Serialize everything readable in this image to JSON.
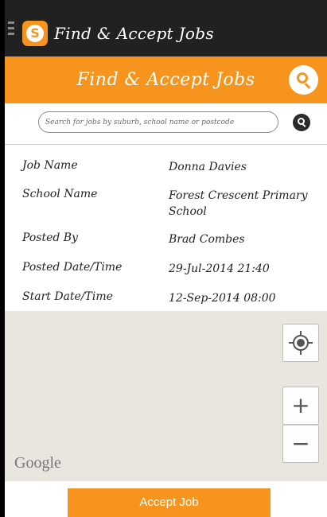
{
  "app": {
    "title": "Find & Accept Jobs",
    "logo_letter": "S"
  },
  "header": {
    "title": "Find & Accept Jobs"
  },
  "search": {
    "placeholder": "Search for jobs by suburb, school name or postcode"
  },
  "details": [
    {
      "label": "Job Name",
      "value": "Donna Davies"
    },
    {
      "label": "School Name",
      "value": "Forest Crescent Primary School"
    },
    {
      "label": "Posted By",
      "value": "Brad Combes"
    },
    {
      "label": "Posted Date/Time",
      "value": "29-Jul-2014 21:40"
    },
    {
      "label": "Start Date/Time",
      "value": "12-Sep-2014 08:00"
    }
  ],
  "map": {
    "attribution": "Google",
    "zoom_in": "+",
    "zoom_out": "−"
  },
  "actions": {
    "accept_label": "Accept Job"
  },
  "colors": {
    "accent": "#f7941d",
    "actionbar": "#212121",
    "map_bg": "#e8e6df"
  },
  "icons": [
    "menu-icon",
    "app-logo-icon",
    "search-icon",
    "my-location-icon",
    "zoom-in-icon",
    "zoom-out-icon"
  ]
}
